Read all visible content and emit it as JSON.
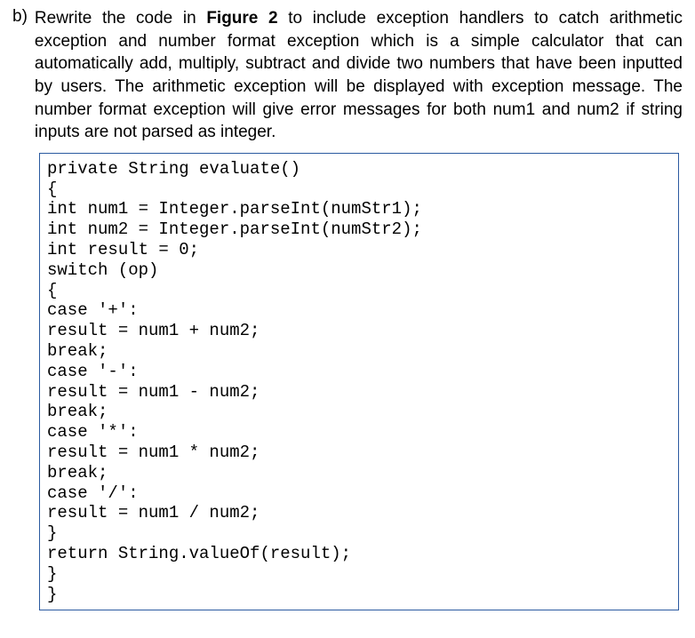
{
  "question": {
    "label": "b)",
    "text_pre": "Rewrite the code in ",
    "figure_ref": "Figure 2",
    "text_post": " to include exception handlers to catch arithmetic exception and number format exception which is a simple calculator that can automatically add, multiply, subtract and divide two numbers that have been inputted by users. The arithmetic exception will be displayed with exception message. The number format exception will give error messages for both num1 and num2 if string inputs are not parsed as integer."
  },
  "code": {
    "l01": "private String evaluate()",
    "l02": "{",
    "l03": "int num1 = Integer.parseInt(numStr1);",
    "l04": "int num2 = Integer.parseInt(numStr2);",
    "l05": "int result = 0;",
    "l06": "switch (op)",
    "l07": "{",
    "l08": "case '+':",
    "l09": "result = num1 + num2;",
    "l10": "break;",
    "l11": "case '-':",
    "l12": "result = num1 - num2;",
    "l13": "break;",
    "l14": "case '*':",
    "l15": "result = num1 * num2;",
    "l16": "break;",
    "l17": "case '/':",
    "l18": "result = num1 / num2;",
    "l19": "}",
    "l20": "return String.valueOf(result);",
    "l21": "}",
    "l22": "}"
  }
}
